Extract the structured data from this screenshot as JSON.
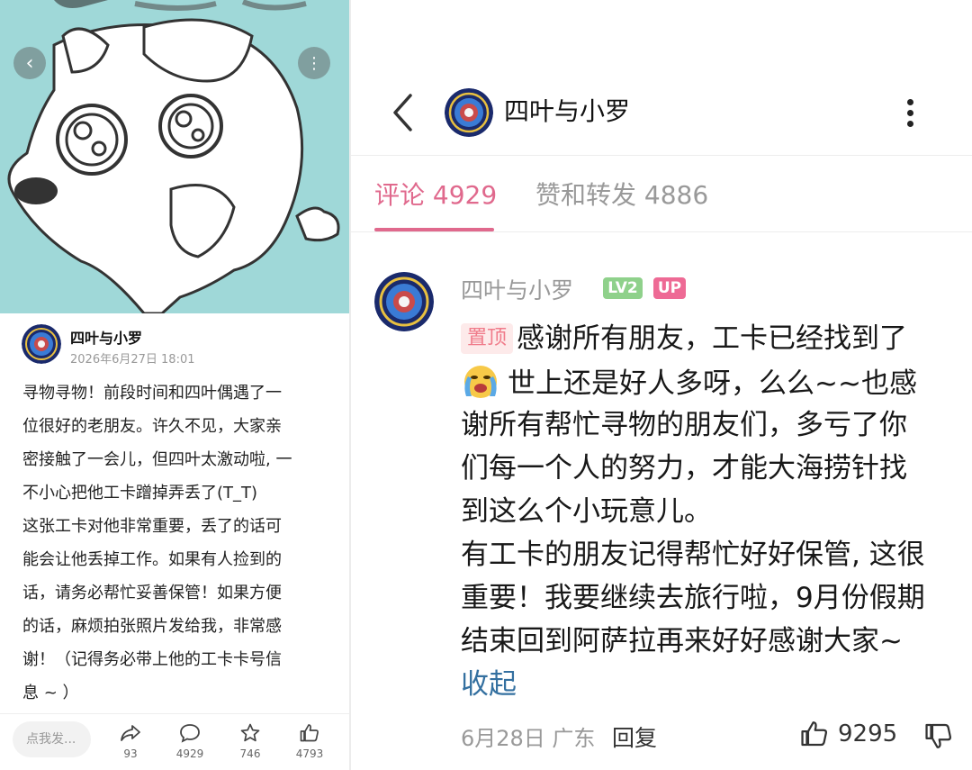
{
  "left": {
    "author": "四叶与小罗",
    "date": "2026年6月27日 18:01",
    "post_lines": [
      "寻物寻物！前段时间和四叶偶遇了一",
      "位很好的老朋友。许久不见，大家亲",
      "密接触了一会儿，但四叶太激动啦, 一",
      "不小心把他工卡蹭掉弄丢了(T_T)",
      "这张工卡对他非常重要，丢了的话可",
      "能会让他丢掉工作。如果有人捡到的",
      "话，请务必帮忙妥善保管！如果方便",
      "的话，麻烦拍张照片发给我，非常感",
      "谢！（记得务必带上他的工卡卡号信",
      "息 ~ ）"
    ],
    "comment_placeholder": "点我发...",
    "actions": [
      {
        "icon": "share-icon",
        "count": "93"
      },
      {
        "icon": "comment-icon",
        "count": "4929"
      },
      {
        "icon": "star-icon",
        "count": "746"
      },
      {
        "icon": "thumbs-up-icon",
        "count": "4793"
      }
    ]
  },
  "right": {
    "title": "四叶与小罗",
    "tabs": {
      "comments": "评论 4929",
      "likes": "赞和转发 4886"
    },
    "comment": {
      "author": "四叶与小罗",
      "level_badge": "LV2",
      "up_badge": "UP",
      "pin_label": "置顶",
      "lines": [
        "感谢所有朋友，工卡已经找到了",
        "世上还是好人多呀，么么~~也感",
        "谢所有帮忙寻物的朋友们，多亏了你",
        "们每一个人的努力，才能大海捞针找",
        "到这么个小玩意儿。",
        "有工卡的朋友记得帮忙好好保管, 这很",
        "重要！我要继续去旅行啦，9月份假期",
        "结束回到阿萨拉再来好好感谢大家~"
      ],
      "collapse_label": "收起",
      "meta": "6月28日 广东",
      "reply_label": "回复",
      "like_count": "9295"
    }
  },
  "colors": {
    "accent_pink": "#e0698d",
    "level_green": "#8fd18b",
    "up_pink": "#ee6a95",
    "link_blue": "#3470a0",
    "hero_bg": "#9fd8d8"
  }
}
